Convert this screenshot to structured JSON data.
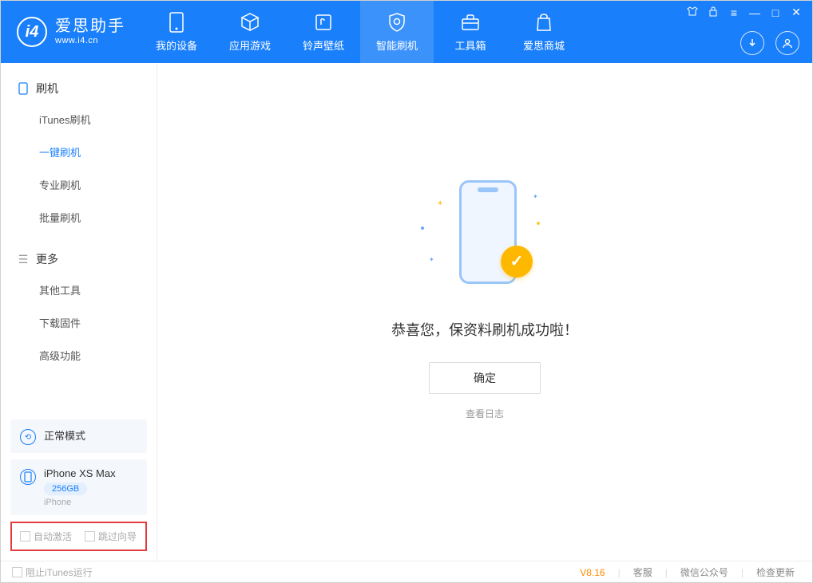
{
  "logo": {
    "title": "爱思助手",
    "subtitle": "www.i4.cn"
  },
  "nav": {
    "device": "我的设备",
    "apps": "应用游戏",
    "ringtone": "铃声壁纸",
    "flash": "智能刷机",
    "toolbox": "工具箱",
    "store": "爱思商城"
  },
  "sidebar": {
    "section1": "刷机",
    "items1": {
      "itunes": "iTunes刷机",
      "oneclick": "一键刷机",
      "pro": "专业刷机",
      "batch": "批量刷机"
    },
    "section2": "更多",
    "items2": {
      "other": "其他工具",
      "firmware": "下载固件",
      "advanced": "高级功能"
    },
    "mode_card": "正常模式",
    "device_card": {
      "name": "iPhone XS Max",
      "storage": "256GB",
      "type": "iPhone"
    },
    "options": {
      "auto_activate": "自动激活",
      "skip_guide": "跳过向导"
    }
  },
  "main": {
    "success_text": "恭喜您，保资料刷机成功啦！",
    "ok_btn": "确定",
    "view_log": "查看日志"
  },
  "footer": {
    "block_itunes": "阻止iTunes运行",
    "version": "V8.16",
    "support": "客服",
    "wechat": "微信公众号",
    "update": "检查更新"
  }
}
